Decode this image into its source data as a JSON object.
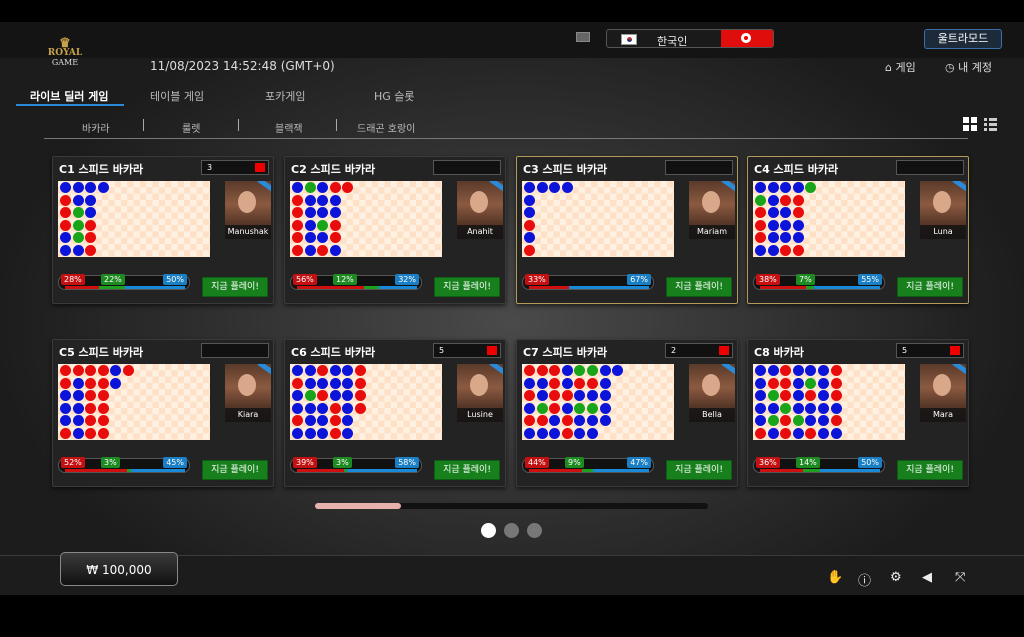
{
  "brand": {
    "line1": "ROYAL",
    "line2": "GAME"
  },
  "header": {
    "datetime": "11/08/2023 14:52:48 (GMT+0)",
    "language": "한국인",
    "ultra_mode": "울트라모드",
    "games_link": "게임",
    "my_account_link": "내 계정"
  },
  "tabs": [
    "라이브 딜러 게임",
    "테이블 게임",
    "포카게임",
    "HG 슬롯"
  ],
  "subtabs": [
    "바카라",
    "룰렛",
    "블랙잭",
    "드래곤 호랑이"
  ],
  "play_label": "지금 플레이!",
  "tables": [
    {
      "title": "C1 스피드 바카라",
      "count": "3",
      "dealer": "Manushak",
      "banker_pct": "28%",
      "tie_pct": "22%",
      "player_pct": "50%",
      "banker": 0.28,
      "tie": 0.22,
      "highlight": false,
      "road": [
        "bbbb",
        "rbb",
        "rgb",
        "rgr",
        "bgr",
        "bbr"
      ]
    },
    {
      "title": "C2 스피드 바카라",
      "count": "",
      "dealer": "Anahit",
      "banker_pct": "56%",
      "tie_pct": "12%",
      "player_pct": "32%",
      "banker": 0.56,
      "tie": 0.12,
      "highlight": false,
      "road": [
        "bgbrr",
        "rbbb",
        "rbbb",
        "rbgr",
        "rbbr",
        "rbrb"
      ]
    },
    {
      "title": "C3 스피드 바카라",
      "count": "",
      "dealer": "Mariam",
      "banker_pct": "33%",
      "tie_pct": "",
      "player_pct": "67%",
      "banker": 0.33,
      "tie": 0.0,
      "highlight": true,
      "road": [
        "bbbb",
        "b",
        "b",
        "r",
        "b",
        "r"
      ]
    },
    {
      "title": "C4 스피드 바카라",
      "count": "",
      "dealer": "Luna",
      "banker_pct": "38%",
      "tie_pct": "7%",
      "player_pct": "55%",
      "banker": 0.38,
      "tie": 0.07,
      "highlight": true,
      "road": [
        "bbbbg",
        "gbrr",
        "rbbr",
        "rbbb",
        "rbbb",
        "bbrr"
      ]
    },
    {
      "title": "C5 스피드 바카라",
      "count": "",
      "dealer": "Kiara",
      "banker_pct": "52%",
      "tie_pct": "3%",
      "player_pct": "45%",
      "banker": 0.52,
      "tie": 0.03,
      "highlight": false,
      "road": [
        "rrrrbr",
        "rbrrb",
        "bbrr",
        "bbrr",
        "bbrr",
        "rbrr"
      ]
    },
    {
      "title": "C6 스피드 바카라",
      "count": "5",
      "dealer": "Lusine",
      "banker_pct": "39%",
      "tie_pct": "3%",
      "player_pct": "58%",
      "banker": 0.39,
      "tie": 0.03,
      "highlight": false,
      "road": [
        "bbrbbr",
        "rbbbbr",
        "bgrbbr",
        "bbbrbr",
        "rbbrb",
        "bbbrb"
      ]
    },
    {
      "title": "C7 스피드 바카라",
      "count": "2",
      "dealer": "Bella",
      "banker_pct": "44%",
      "tie_pct": "9%",
      "player_pct": "47%",
      "banker": 0.44,
      "tie": 0.09,
      "highlight": false,
      "road": [
        "rrrbggbb",
        "bbrbrrb",
        "rbrrbbb",
        "bgrbggb",
        "rrbrbbb",
        "bbbrbb"
      ]
    },
    {
      "title": "C8 바카라",
      "count": "5",
      "dealer": "Mara",
      "banker_pct": "36%",
      "tie_pct": "14%",
      "player_pct": "50%",
      "banker": 0.36,
      "tie": 0.14,
      "highlight": false,
      "road": [
        "bbrbbbr",
        "brrbgbr",
        "bgrbrbr",
        "bbgbbbb",
        "bgrgbbr",
        "rbrbrbb"
      ]
    }
  ],
  "balance": "₩ 100,000",
  "icons": {
    "mail": "mail-icon",
    "home": "home-icon",
    "clock": "clock-icon",
    "grid": "grid-view-icon",
    "list": "list-view-icon"
  }
}
